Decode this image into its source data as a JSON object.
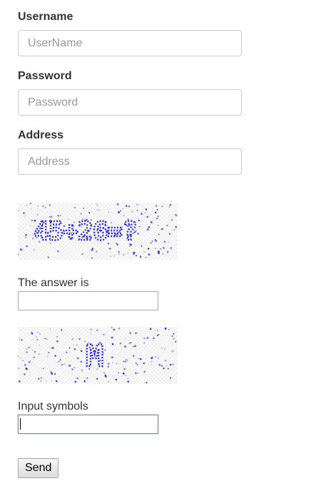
{
  "form": {
    "username": {
      "label": "Username",
      "placeholder": "UserName",
      "value": ""
    },
    "password": {
      "label": "Password",
      "placeholder": "Password",
      "value": ""
    },
    "address": {
      "label": "Address",
      "placeholder": "Address",
      "value": ""
    },
    "math_captcha": {
      "image_text": "45+26=?",
      "prompt": "The answer is",
      "value": ""
    },
    "symbol_captcha": {
      "image_text": "M",
      "prompt": "Input symbols",
      "value": ""
    },
    "send_label": "Send"
  },
  "colors": {
    "captcha_ink": "#2a2ad6",
    "focus_border": "#5b8fd8"
  }
}
